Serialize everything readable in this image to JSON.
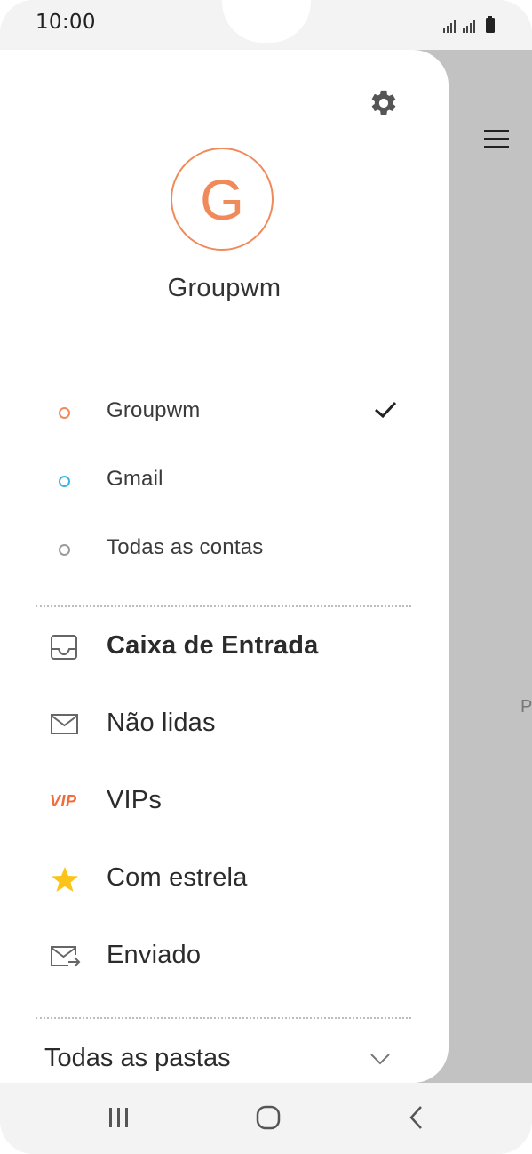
{
  "status_bar": {
    "time": "10:00"
  },
  "drawer": {
    "avatar_letter": "G",
    "profile_name": "Groupwm",
    "accounts": [
      {
        "label": "Groupwm",
        "dot_color": "#f08a5b",
        "selected": true
      },
      {
        "label": "Gmail",
        "dot_color": "#39b4e6",
        "selected": false
      },
      {
        "label": "Todas as contas",
        "dot_color": "#9a9a9a",
        "selected": false
      }
    ],
    "folders": [
      {
        "label": "Caixa de Entrada",
        "icon": "inbox-icon",
        "bold": true
      },
      {
        "label": "Não lidas",
        "icon": "envelope-icon",
        "bold": false
      },
      {
        "label": "VIPs",
        "icon": "vip-icon",
        "icon_text": "VIP",
        "bold": false
      },
      {
        "label": "Com estrela",
        "icon": "star-icon",
        "bold": false
      },
      {
        "label": "Enviado",
        "icon": "sent-icon",
        "bold": false
      }
    ],
    "all_folders_label": "Todas as pastas"
  },
  "background_app": {
    "partial_letter": "P"
  },
  "colors": {
    "accent": "#f08a5b",
    "gmail": "#39b4e6",
    "vip": "#f26b3a",
    "star": "#fcc419",
    "scrim": "#c2c2c2"
  },
  "navigation": {
    "buttons": [
      "recents-icon",
      "home-icon",
      "back-icon"
    ]
  }
}
